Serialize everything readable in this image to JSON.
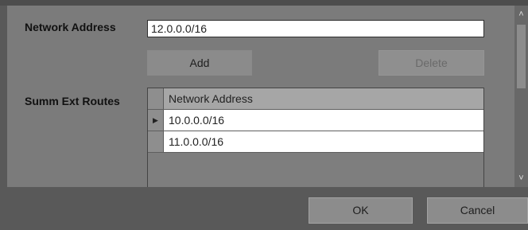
{
  "form": {
    "network_address_label": "Network Address",
    "network_address_value": "12.0.0.0/16",
    "add_label": "Add",
    "delete_label": "Delete",
    "summ_ext_routes_label": "Summ Ext Routes"
  },
  "grid": {
    "column_header": "Network Address",
    "current_row_marker": "▶",
    "rows": [
      "10.0.0.0/16",
      "11.0.0.0/16"
    ]
  },
  "footer": {
    "ok_label": "OK",
    "cancel_label": "Cancel"
  },
  "scrollbar": {
    "up_icon": "˄",
    "down_icon": "˅"
  },
  "colors": {
    "dialog_bg": "#595959",
    "panel_bg": "#7b7b7b",
    "header_bg": "#a6a6a6"
  }
}
